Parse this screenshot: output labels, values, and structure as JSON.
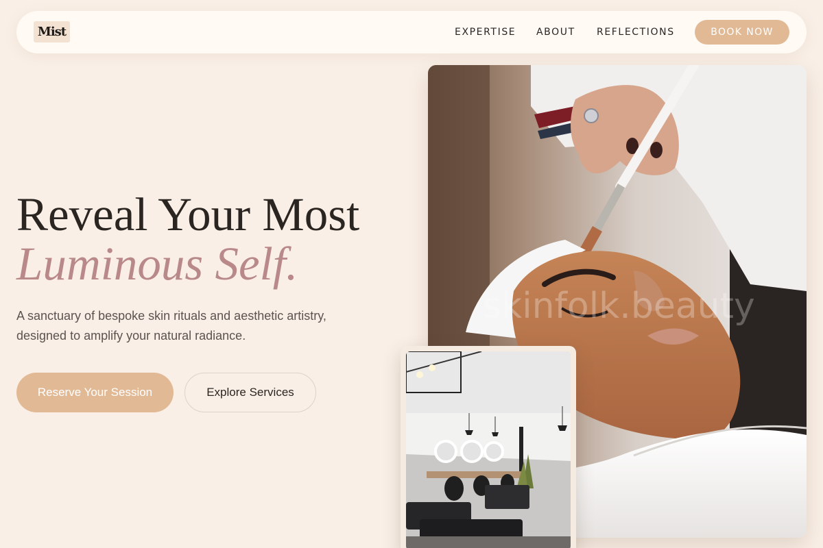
{
  "brand": {
    "logo": "Mist"
  },
  "nav": {
    "links": [
      "EXPERTISE",
      "ABOUT",
      "REFLECTIONS"
    ],
    "cta": "BOOK NOW"
  },
  "hero": {
    "headline_line1": "Reveal Your Most",
    "headline_line2": "Luminous Self.",
    "subtitle": "A sanctuary of bespoke skin rituals and aesthetic artistry, designed to amplify your natural radiance.",
    "primary_button": "Reserve Your Session",
    "secondary_button": "Explore Services"
  },
  "images": {
    "main_watermark": "skinfolk.beauty"
  },
  "colors": {
    "background": "#f9efe6",
    "accent": "#e2b995",
    "headline_accent": "#b9898a",
    "text": "#2b2522"
  }
}
